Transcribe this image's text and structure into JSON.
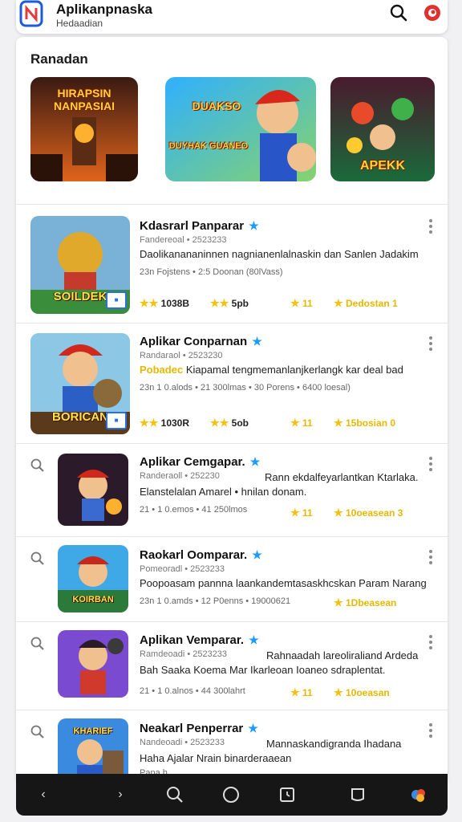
{
  "header": {
    "title": "Aplikanpnaska",
    "subtitle": "Hedaadian"
  },
  "section": {
    "title": "Ranadan"
  },
  "featured": [
    {
      "caption": "HIRAPSIN NANPASIAI"
    },
    {
      "caption_top": "DUAKSO",
      "caption_bottom": "DUYHAK GUANEO"
    },
    {
      "caption": "APEKK"
    }
  ],
  "apps": [
    {
      "title": "Kdasrarl Panparar",
      "developer": "Fandereoal • 2523233",
      "description": "Daolikanananinnen nagnianenlalnaskin dan Sanlen Jadakim",
      "meta": "23n Fojstens • 2:5 Doonan (80lVass)",
      "thumb_label": "SOILDEK",
      "stats": [
        "1038B",
        "5pb",
        "11",
        "Dedostan 1"
      ]
    },
    {
      "title": "Aplikar Conparnan",
      "developer": "Randaraol • 2523230",
      "description_highlight": "Pobadec",
      "description": "Kiapamal tengmemanlanjkerlangk kar deal bad",
      "meta": "23n 1 0.alods • 21 300lmas • 30 Porens • 6400 loesal)",
      "thumb_label": "BORICAN",
      "stats": [
        "1030R",
        "5ob",
        "11",
        "15bosian 0"
      ]
    },
    {
      "title": "Aplikar Cemgapar.",
      "developer": "Randeraoll • 252230",
      "description": "Elanstelalan Amarel • hnilan donam.",
      "description_right": "Rann ekdalfeyarlantkan Ktarlaka.",
      "meta": "21 • 1 0.emos • 41 250lmos",
      "stats": [
        "11",
        "10oeasean 3"
      ]
    },
    {
      "title": "Raokarl Oomparar.",
      "developer": "Pomeoradl • 2523233",
      "description": "Poopoasam pannna laankandemtasaskhcskan Param Narang",
      "meta": "23n 1 0.amds • 12 P0enns • 19000621",
      "thumb_label": "KOIRBAN",
      "stats": [
        "1Dbeasean"
      ]
    },
    {
      "title": "Aplikan Vemparar.",
      "developer": "Ramdeoadi • 2523233",
      "description_right": "Rahnaadah lareoliraliand Ardeda",
      "description": "Bah Saaka Koema Mar Ikarleoan Ioaneo sdraplentat.",
      "meta": "21 • 1 0.alnos • 44 300lahrt",
      "stats": [
        "11",
        "10oeasan"
      ]
    },
    {
      "title": "Neakarl Penperrar",
      "developer": "Nandeoadi • 2523233",
      "description_right": "Mannaskandigranda Ihadana",
      "description": "Haha Ajalar Nrain binarderaaean",
      "meta": "Pana h",
      "thumb_label": "KHARIEF"
    }
  ],
  "colors": {
    "accent": "#1e9bff",
    "star": "#f4c20d",
    "navbar": "#161616"
  }
}
